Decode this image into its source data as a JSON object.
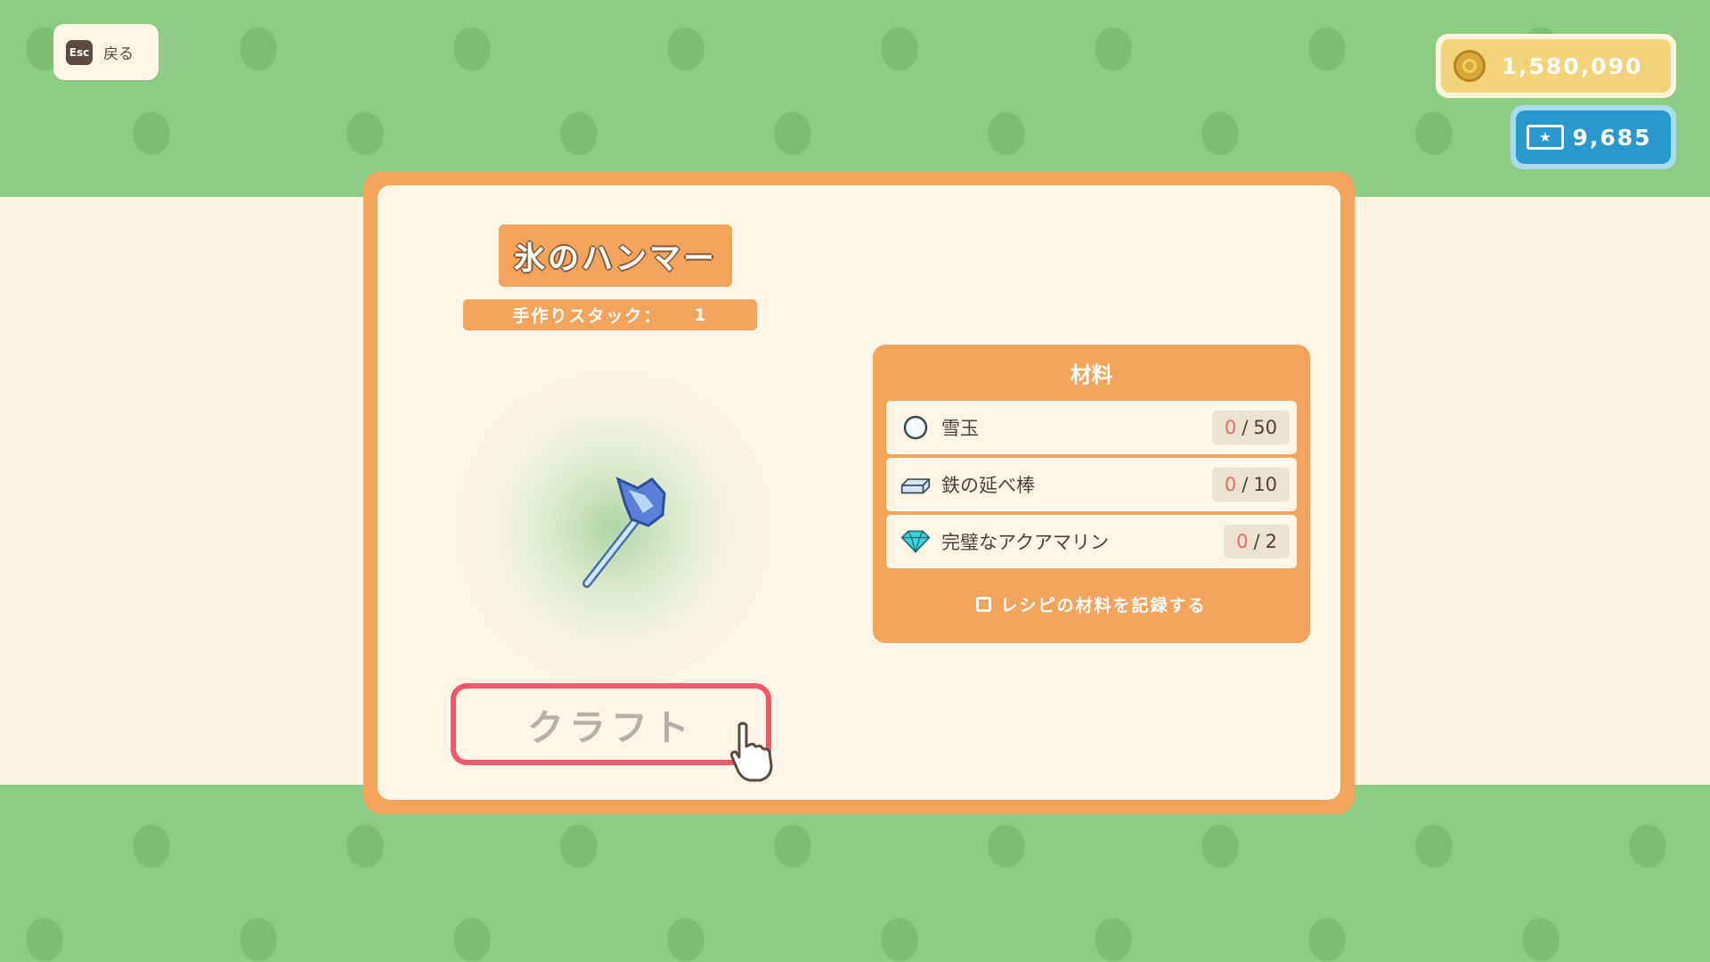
{
  "nav": {
    "esc_key": "Esc",
    "back_label": "戻る"
  },
  "currency": {
    "coins": "1,580,090",
    "tickets": "9,685",
    "coin_icon": "gold-coin-icon",
    "ticket_icon": "ticket-icon"
  },
  "item": {
    "name": "氷のハンマー",
    "stack_label": "手作りスタック：",
    "stack_value": "1",
    "icon": "ice-hammer-icon"
  },
  "craft": {
    "label": "クラフト"
  },
  "materials": {
    "title": "材料",
    "items": [
      {
        "name": "雪玉",
        "have": "0",
        "sep": "/",
        "need": "50",
        "icon": "snowball-icon"
      },
      {
        "name": "鉄の延べ棒",
        "have": "0",
        "sep": "/",
        "need": "10",
        "icon": "iron-bar-icon"
      },
      {
        "name": "完璧なアクアマリン",
        "have": "0",
        "sep": "/",
        "need": "2",
        "icon": "aquamarine-gem-icon"
      }
    ],
    "record_label": "レシピの材料を記録する"
  },
  "colors": {
    "accent_orange": "#f2a35c",
    "cream": "#fef5e6",
    "green_bg": "#8ccc84",
    "craft_border": "#f0586a",
    "missing_red": "#ee6a6a"
  }
}
